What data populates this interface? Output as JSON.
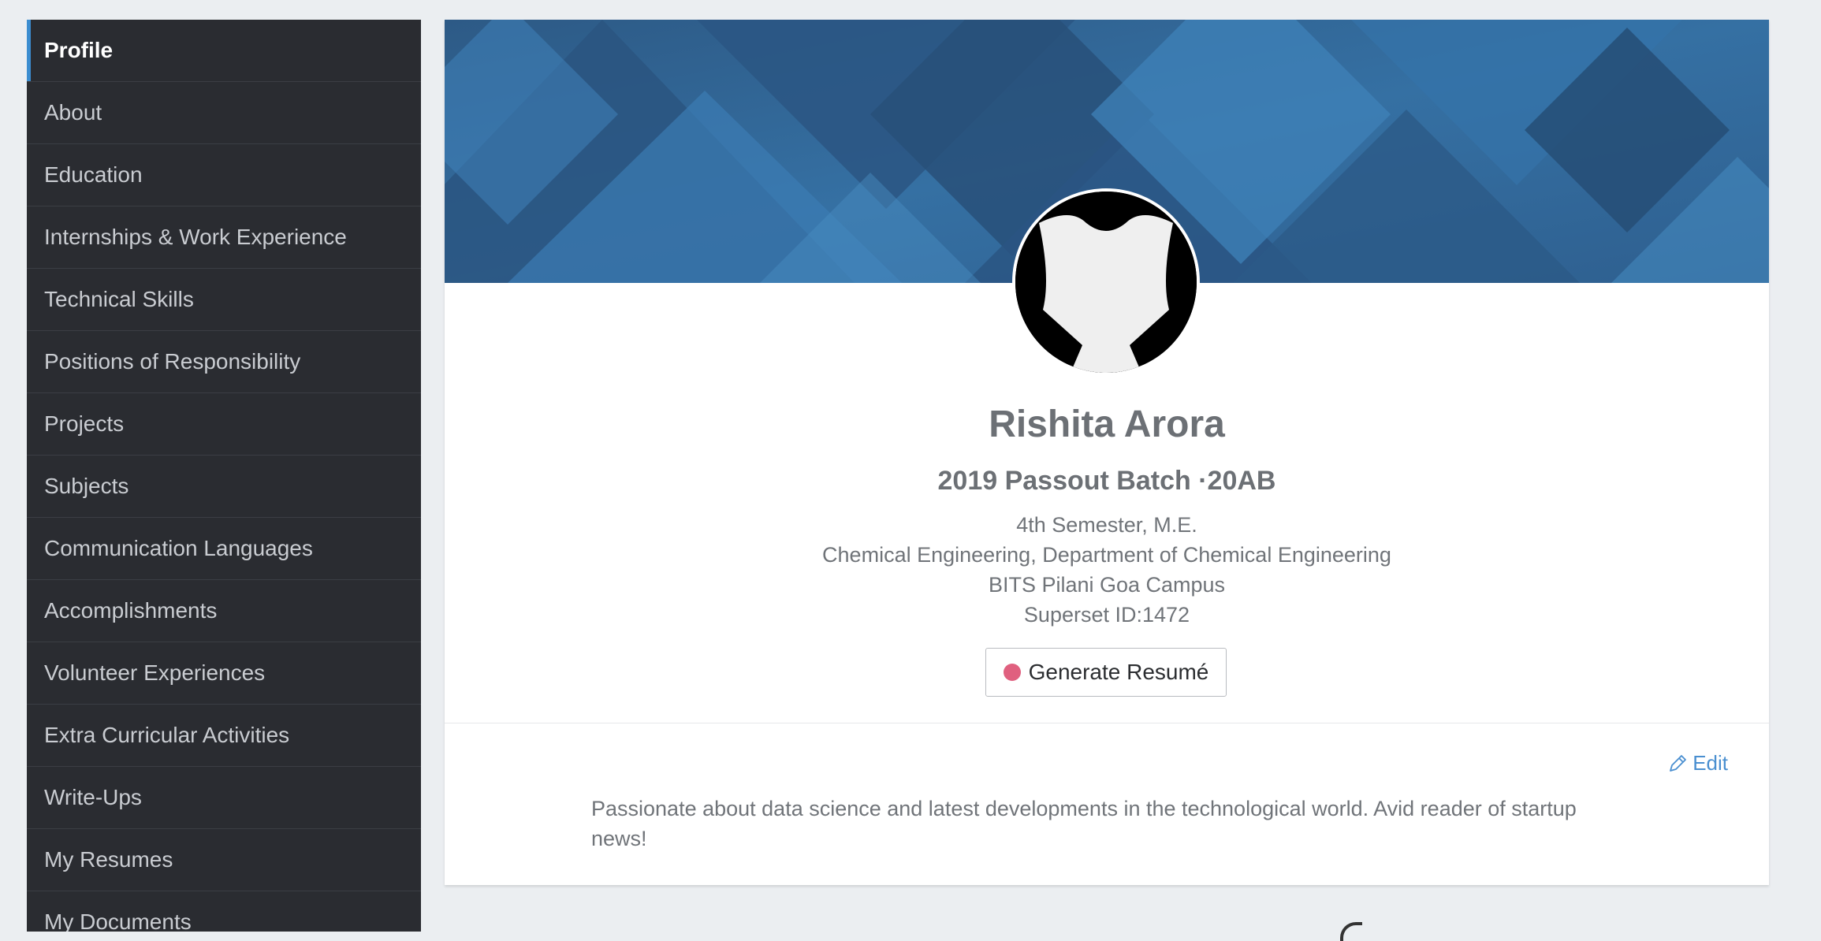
{
  "sidebar": {
    "items": [
      {
        "label": "Profile"
      },
      {
        "label": "About"
      },
      {
        "label": "Education"
      },
      {
        "label": "Internships & Work Experience"
      },
      {
        "label": "Technical Skills"
      },
      {
        "label": "Positions of Responsibility"
      },
      {
        "label": "Projects"
      },
      {
        "label": "Subjects"
      },
      {
        "label": "Communication Languages"
      },
      {
        "label": "Accomplishments"
      },
      {
        "label": "Volunteer Experiences"
      },
      {
        "label": "Extra Curricular Activities"
      },
      {
        "label": "Write-Ups"
      },
      {
        "label": "My Resumes"
      },
      {
        "label": "My Documents"
      }
    ],
    "active_index": 0
  },
  "profile": {
    "name": "Rishita Arora",
    "batch": "2019 Passout Batch ·20AB",
    "semester": "4th Semester, M.E.",
    "department": "Chemical Engineering, Department of Chemical Engineering",
    "campus": "BITS Pilani Goa Campus",
    "superset_id": "Superset ID:1472",
    "generate_button_label": "Generate Resumé",
    "avatar_icon": "person-silhouette-icon"
  },
  "about": {
    "edit_label": "Edit",
    "text": "Passionate about data science and latest developments in the technological world. Avid reader of startup news!"
  },
  "colors": {
    "sidebar_bg": "#2a2c31",
    "active_accent": "#3c8dd0",
    "banner_blue": "#2f5d8c",
    "link_blue": "#4a8fd0",
    "resume_dot": "#e0607f",
    "page_bg": "#ebeef1"
  }
}
